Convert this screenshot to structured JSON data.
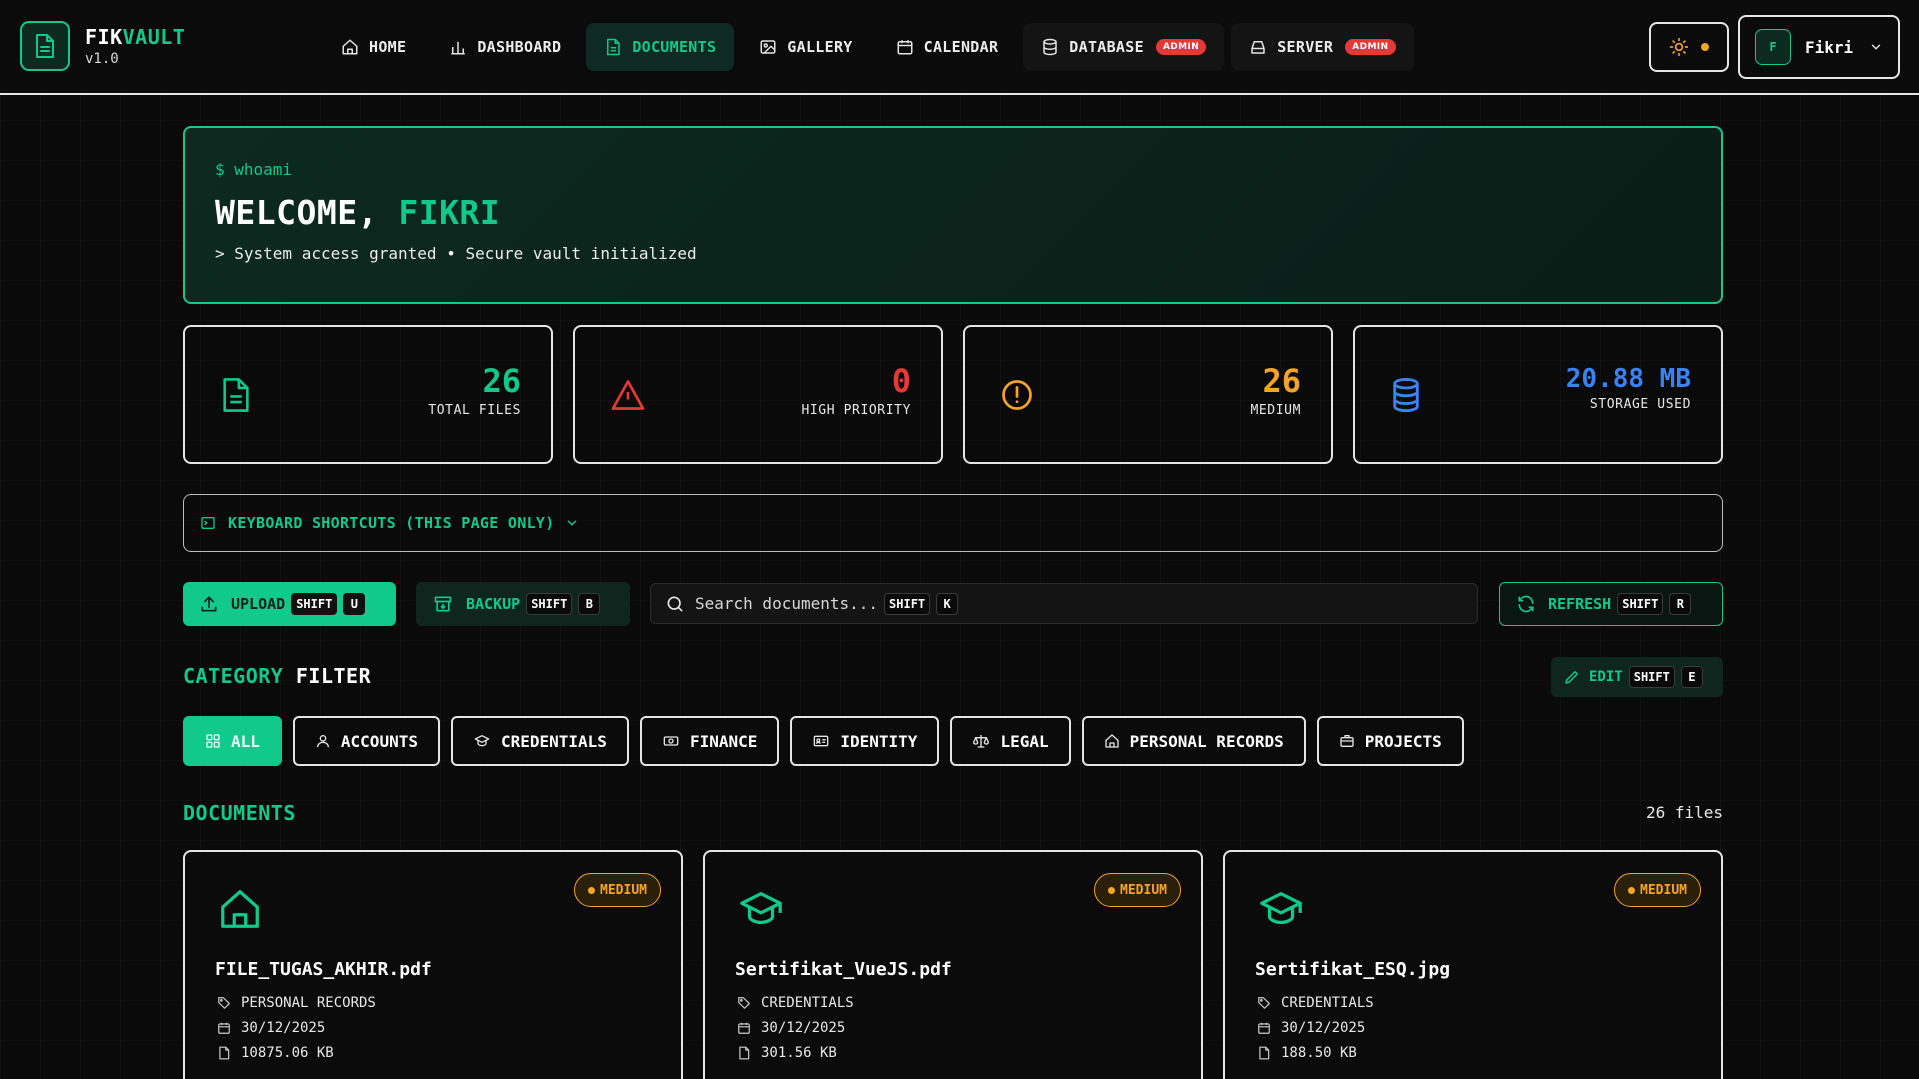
{
  "brand": {
    "name_part1": "FIK",
    "name_part2": "VAULT",
    "version": "v1.0"
  },
  "nav": {
    "home": "HOME",
    "dashboard": "DASHBOARD",
    "documents": "DOCUMENTS",
    "gallery": "GALLERY",
    "calendar": "CALENDAR",
    "database": "DATABASE",
    "server": "SERVER",
    "admin_badge": "ADMIN",
    "active": "documents"
  },
  "user": {
    "initial": "F",
    "name": "Fikri"
  },
  "welcome": {
    "prompt": "$ whoami",
    "title_prefix": "WELCOME,",
    "title_name": "FIKRI",
    "subtitle": "> System access granted • Secure vault initialized"
  },
  "stats": {
    "total_files": {
      "value": "26",
      "label": "TOTAL FILES"
    },
    "high_priority": {
      "value": "0",
      "label": "HIGH PRIORITY"
    },
    "medium": {
      "value": "26",
      "label": "MEDIUM"
    },
    "storage": {
      "value": "20.88 MB",
      "label": "STORAGE USED"
    }
  },
  "shortcuts": {
    "label": "KEYBOARD SHORTCUTS (THIS PAGE ONLY)"
  },
  "actions": {
    "upload": {
      "label": "UPLOAD",
      "mod": "SHIFT",
      "key": "U"
    },
    "backup": {
      "label": "BACKUP",
      "mod": "SHIFT",
      "key": "B"
    },
    "search": {
      "placeholder": "Search documents...",
      "mod": "SHIFT",
      "key": "K"
    },
    "refresh": {
      "label": "REFRESH",
      "mod": "SHIFT",
      "key": "R"
    }
  },
  "category": {
    "title_a": "CATEGORY",
    "title_b": "FILTER",
    "edit": {
      "label": "EDIT",
      "mod": "SHIFT",
      "key": "E"
    },
    "chips": [
      "ALL",
      "ACCOUNTS",
      "CREDENTIALS",
      "FINANCE",
      "IDENTITY",
      "LEGAL",
      "PERSONAL RECORDS",
      "PROJECTS"
    ],
    "selected": "ALL"
  },
  "documents": {
    "title": "DOCUMENTS",
    "count": "26 files",
    "items": [
      {
        "name": "FILE_TUGAS_AKHIR.pdf",
        "priority": "MEDIUM",
        "category": "PERSONAL RECORDS",
        "date": "30/12/2025",
        "size": "10875.06 KB",
        "icon": "home-icon"
      },
      {
        "name": "Sertifikat_VueJS.pdf",
        "priority": "MEDIUM",
        "category": "CREDENTIALS",
        "date": "30/12/2025",
        "size": "301.56 KB",
        "icon": "graduation-cap-icon"
      },
      {
        "name": "Sertifikat_ESQ.jpg",
        "priority": "MEDIUM",
        "category": "CREDENTIALS",
        "date": "30/12/2025",
        "size": "188.50 KB",
        "icon": "graduation-cap-icon"
      }
    ]
  },
  "colors": {
    "accent": "#10c98a",
    "danger": "#e53935",
    "warning": "#f5a524",
    "info": "#3b82f6",
    "background": "#0a0a0a"
  }
}
